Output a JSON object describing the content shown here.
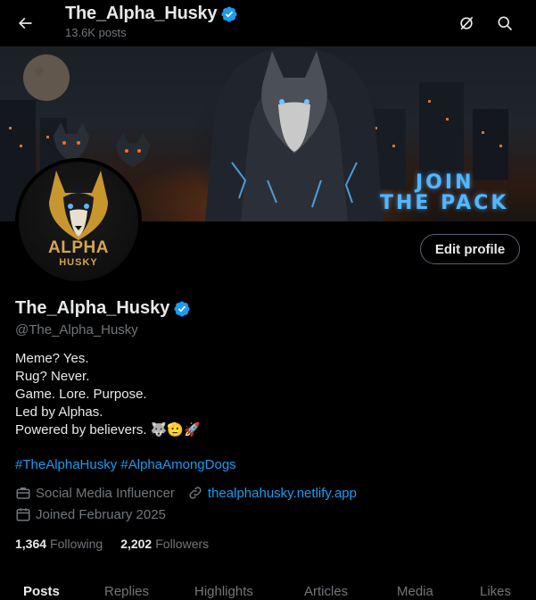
{
  "header": {
    "title": "The_Alpha_Husky",
    "posts_count": "13.6K posts"
  },
  "banner": {
    "line1": "JOIN",
    "line2": "THE PACK"
  },
  "avatar": {
    "word1": "ALPHA",
    "word2": "HUSKY"
  },
  "actions": {
    "edit_profile": "Edit profile"
  },
  "profile": {
    "name": "The_Alpha_Husky",
    "handle": "@The_Alpha_Husky",
    "bio": [
      "Meme? Yes.",
      "Rug? Never.",
      "Game. Lore. Purpose.",
      "Led by Alphas.",
      "Powered by believers. 🐺🫡🚀"
    ],
    "hashtags": [
      "#TheAlphaHusky",
      "#AlphaAmongDogs"
    ],
    "category": "Social Media Influencer",
    "website": "thealphahusky.netlify.app",
    "joined": "Joined February 2025",
    "following_count": "1,364",
    "following_label": "Following",
    "followers_count": "2,202",
    "followers_label": "Followers"
  },
  "tabs": [
    "Posts",
    "Replies",
    "Highlights",
    "Articles",
    "Media",
    "Likes"
  ],
  "colors": {
    "accent": "#1d9bf0",
    "muted": "#71767b",
    "text": "#e7e9ea",
    "verified": "#1d9bf0",
    "avatar_gold": "#d6a64a"
  },
  "icons": {
    "back": "arrow-left-icon",
    "grok": "grok-icon",
    "search": "search-icon",
    "verified": "verified-badge-icon",
    "category": "briefcase-icon",
    "link": "link-icon",
    "calendar": "calendar-icon"
  }
}
